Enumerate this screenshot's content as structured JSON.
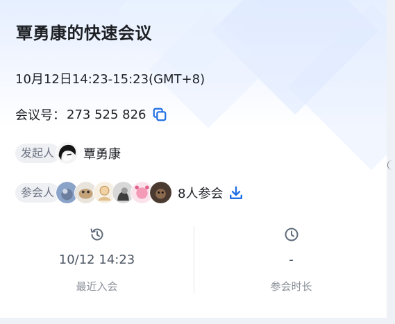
{
  "meeting": {
    "title": "覃勇康的快速会议",
    "time": "10月12日14:23-15:23(GMT+8)",
    "id_label": "会议号：",
    "id_value": "273 525 826"
  },
  "organizer": {
    "tag": "发起人",
    "name": "覃勇康"
  },
  "attendees": {
    "tag": "参会人",
    "count_text": "8人参会",
    "avatar_count": 6
  },
  "stats": {
    "last_join": {
      "value": "10/12 14:23",
      "label": "最近入会"
    },
    "duration": {
      "value": "-",
      "label": "参会时长"
    }
  },
  "colors": {
    "accent": "#1f6fe5",
    "text": "#1c1f23",
    "muted": "#8a9099"
  },
  "icons": {
    "copy": "copy-icon",
    "download": "download-icon",
    "history": "history-icon",
    "clock": "clock-icon"
  }
}
